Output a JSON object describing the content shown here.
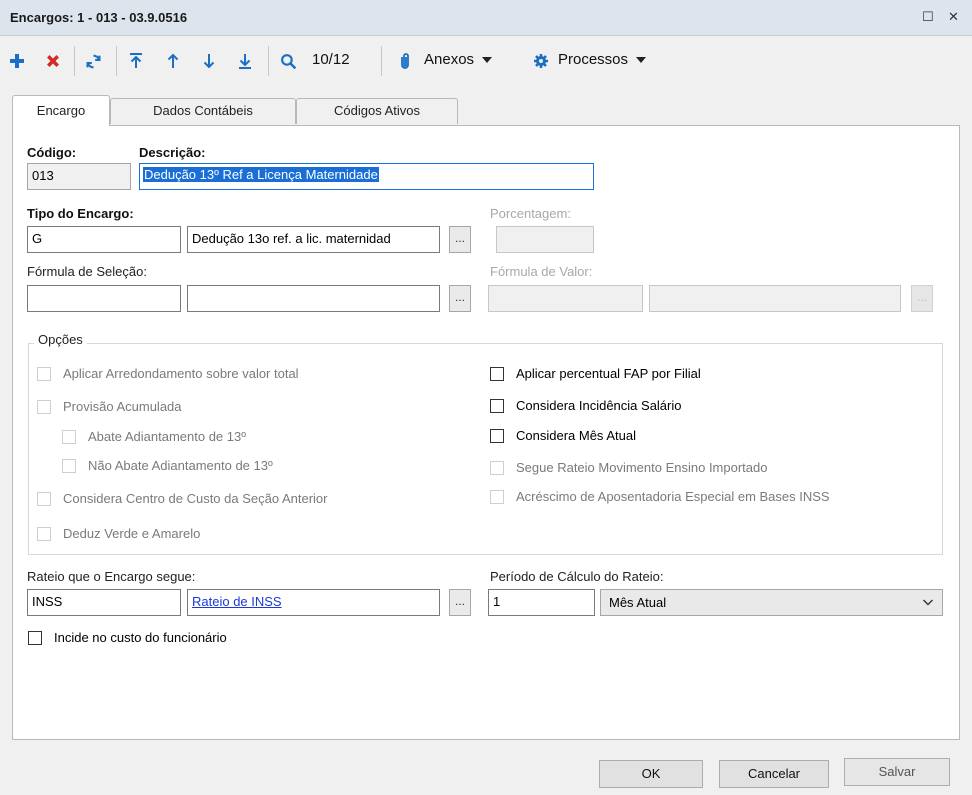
{
  "window": {
    "title": "Encargos: 1 - 013 - 03.9.0516",
    "maximize_glyph": "☐",
    "close_glyph": "✕"
  },
  "toolbar": {
    "record_position": "10/12",
    "attachments_label": "Anexos",
    "processes_label": "Processos",
    "icons": [
      "add-icon",
      "delete-icon",
      "refresh-icon",
      "first-icon",
      "previous-icon",
      "next-icon",
      "last-icon",
      "search-icon",
      "paperclip-icon",
      "gear-icon"
    ],
    "colors": {
      "add": "#1a6fc4",
      "delete": "#d32a2a",
      "nav": "#1a6fc4"
    }
  },
  "tabs": [
    {
      "label": "Encargo",
      "active": true
    },
    {
      "label": "Dados Contábeis",
      "active": false
    },
    {
      "label": "Códigos Ativos",
      "active": false
    }
  ],
  "form": {
    "codigo": {
      "label": "Código:",
      "value": "013"
    },
    "descricao": {
      "label": "Descrição:",
      "value": "Dedução 13º Ref a Licença Maternidade"
    },
    "tipo_encargo": {
      "label": "Tipo do Encargo:",
      "code": "G",
      "description": "Dedução 13o ref. a lic. maternidad",
      "lookup": "..."
    },
    "porcentagem": {
      "label": "Porcentagem:",
      "value": ""
    },
    "formula_selecao": {
      "label": "Fórmula de Seleção:",
      "code": "",
      "description": "",
      "lookup": "..."
    },
    "formula_valor": {
      "label": "Fórmula de Valor:",
      "code": "",
      "description": "",
      "lookup": "..."
    },
    "opcoes": {
      "title": "Opções",
      "left": [
        {
          "label": "Aplicar Arredondamento sobre valor total",
          "checked": false,
          "enabled": false
        },
        {
          "label": "Provisão Acumulada",
          "checked": false,
          "enabled": false
        },
        {
          "label": "Abate Adiantamento de 13º",
          "checked": false,
          "enabled": false
        },
        {
          "label": "Não Abate Adiantamento de 13º",
          "checked": false,
          "enabled": false
        },
        {
          "label": "Considera Centro de Custo da Seção Anterior",
          "checked": false,
          "enabled": false
        },
        {
          "label": "Deduz Verde e Amarelo",
          "checked": false,
          "enabled": false
        }
      ],
      "right": [
        {
          "label": "Aplicar percentual FAP por Filial",
          "checked": false,
          "enabled": true
        },
        {
          "label": "Considera Incidência Salário",
          "checked": false,
          "enabled": true
        },
        {
          "label": "Considera Mês Atual",
          "checked": false,
          "enabled": true
        },
        {
          "label": "Segue Rateio Movimento Ensino Importado",
          "checked": false,
          "enabled": false
        },
        {
          "label": "Acréscimo de Aposentadoria Especial em Bases INSS",
          "checked": false,
          "enabled": false
        }
      ]
    },
    "rateio": {
      "label": "Rateio que o Encargo segue:",
      "code": "INSS",
      "description": "Rateio de INSS",
      "lookup": "..."
    },
    "periodo": {
      "label": "Período de Cálculo do Rateio:",
      "value": "1",
      "option": "Mês Atual"
    },
    "incide_custo": {
      "label": "Incide no custo do funcionário",
      "checked": false
    }
  },
  "buttons": {
    "ok": "OK",
    "cancel": "Cancelar",
    "save": "Salvar"
  }
}
